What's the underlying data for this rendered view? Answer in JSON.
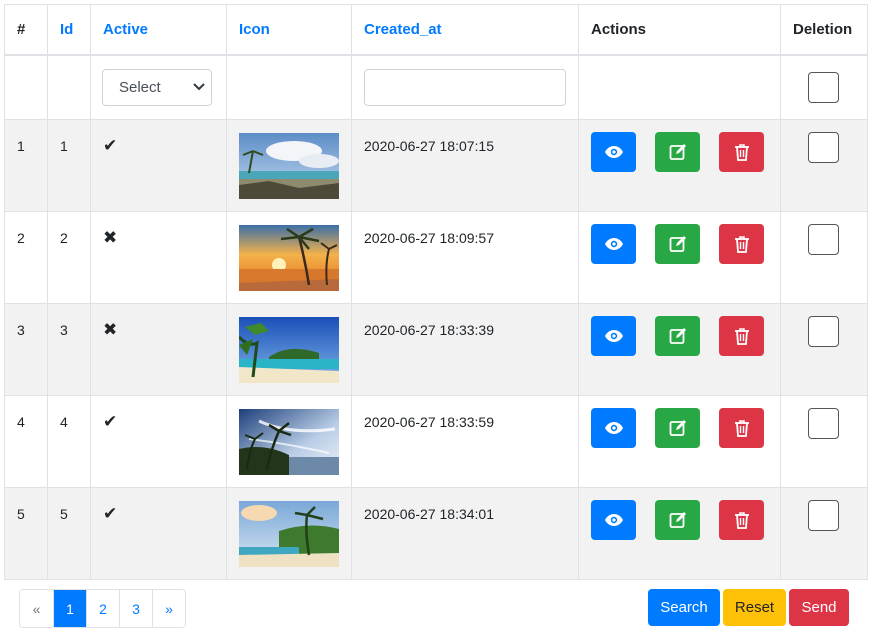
{
  "headers": {
    "num": "#",
    "id": "Id",
    "active": "Active",
    "icon": "Icon",
    "created_at": "Created_at",
    "actions": "Actions",
    "deletion": "Deletion"
  },
  "filters": {
    "active_select": "Select",
    "created_at_value": ""
  },
  "rows": [
    {
      "num": "1",
      "id": "1",
      "active": "✔",
      "icon": "beach-shore-image",
      "created_at": "2020-06-27 18:07:15"
    },
    {
      "num": "2",
      "id": "2",
      "active": "✖",
      "icon": "sunset-palm-image",
      "created_at": "2020-06-27 18:09:57"
    },
    {
      "num": "3",
      "id": "3",
      "active": "✖",
      "icon": "tropical-bay-image",
      "created_at": "2020-06-27 18:33:39"
    },
    {
      "num": "4",
      "id": "4",
      "active": "✔",
      "icon": "palm-sky-image",
      "created_at": "2020-06-27 18:33:59"
    },
    {
      "num": "5",
      "id": "5",
      "active": "✔",
      "icon": "palm-beach-image",
      "created_at": "2020-06-27 18:34:01"
    }
  ],
  "action_icons": {
    "view": "eye-icon",
    "edit": "edit-icon",
    "delete": "trash-icon"
  },
  "pagination": {
    "prev": "«",
    "pages": [
      "1",
      "2",
      "3"
    ],
    "next": "»",
    "active_page": "1"
  },
  "buttons": {
    "search": "Search",
    "reset": "Reset",
    "send": "Send"
  },
  "colors": {
    "primary": "#007bff",
    "success": "#28a745",
    "danger": "#dc3545",
    "warning": "#ffc107",
    "stripe": "#f2f2f2"
  }
}
